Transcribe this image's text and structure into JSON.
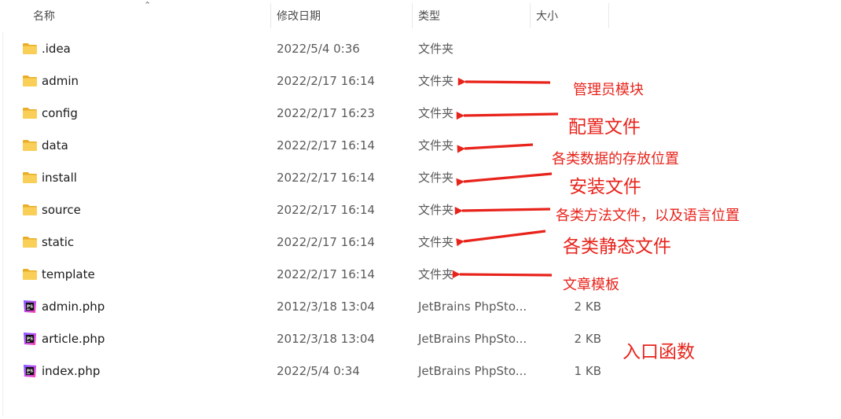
{
  "columns": {
    "name": "名称",
    "modified": "修改日期",
    "type": "类型",
    "size": "大小"
  },
  "files": [
    {
      "name": ".idea",
      "modified": "2022/5/4 0:36",
      "type": "文件夹",
      "size": "",
      "icon": "folder-icon"
    },
    {
      "name": "admin",
      "modified": "2022/2/17 16:14",
      "type": "文件夹",
      "size": "",
      "icon": "folder-icon"
    },
    {
      "name": "config",
      "modified": "2022/2/17 16:23",
      "type": "文件夹",
      "size": "",
      "icon": "folder-icon"
    },
    {
      "name": "data",
      "modified": "2022/2/17 16:14",
      "type": "文件夹",
      "size": "",
      "icon": "folder-icon"
    },
    {
      "name": "install",
      "modified": "2022/2/17 16:14",
      "type": "文件夹",
      "size": "",
      "icon": "folder-icon"
    },
    {
      "name": "source",
      "modified": "2022/2/17 16:14",
      "type": "文件夹",
      "size": "",
      "icon": "folder-icon"
    },
    {
      "name": "static",
      "modified": "2022/2/17 16:14",
      "type": "文件夹",
      "size": "",
      "icon": "folder-icon"
    },
    {
      "name": "template",
      "modified": "2022/2/17 16:14",
      "type": "文件夹",
      "size": "",
      "icon": "folder-icon"
    },
    {
      "name": "admin.php",
      "modified": "2012/3/18 13:04",
      "type": "JetBrains PhpSto...",
      "size": "2 KB",
      "icon": "phpstorm-file-icon"
    },
    {
      "name": "article.php",
      "modified": "2012/3/18 13:04",
      "type": "JetBrains PhpSto...",
      "size": "2 KB",
      "icon": "phpstorm-file-icon"
    },
    {
      "name": "index.php",
      "modified": "2022/5/4 0:34",
      "type": "JetBrains PhpSto...",
      "size": "1 KB",
      "icon": "phpstorm-file-icon"
    }
  ],
  "annotations": [
    {
      "text": "管理员模块"
    },
    {
      "text": "配置文件"
    },
    {
      "text": "各类数据的存放位置"
    },
    {
      "text": "安装文件"
    },
    {
      "text": "各类方法文件，以及语言位置"
    },
    {
      "text": "各类静态文件"
    },
    {
      "text": "文章模板"
    },
    {
      "text": "入口函数"
    }
  ],
  "colors": {
    "annotation": "#e8231b",
    "folder": "#f7c544",
    "phpstorm": "#b345f1"
  }
}
